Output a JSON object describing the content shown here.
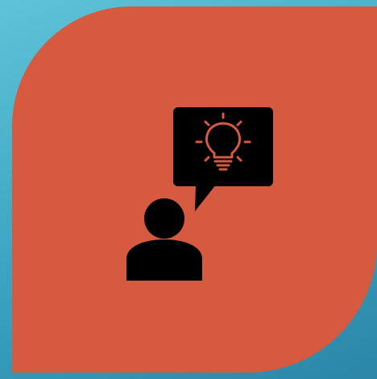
{
  "background": {
    "gradient_start": "#5fc3d8",
    "gradient_end": "#2b86a8"
  },
  "tile": {
    "color": "#d65a40"
  },
  "illustration": {
    "icon_name": "person-with-idea-speech-bubble-icon",
    "foreground_color": "#000000",
    "accent_color": "#d65a40",
    "parts": [
      "user-icon",
      "speech-bubble-icon",
      "lightbulb-icon"
    ]
  }
}
